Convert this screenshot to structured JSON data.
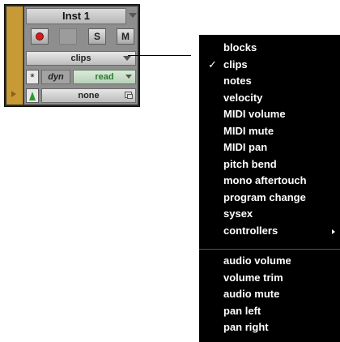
{
  "track": {
    "name": "Inst 1",
    "solo_label": "S",
    "mute_label": "M",
    "view_selector": "clips",
    "dyn_label": "dyn",
    "automation_mode": "read",
    "group": "none",
    "star_symbol": "*"
  },
  "menu": {
    "group1": [
      {
        "label": "blocks",
        "checked": false
      },
      {
        "label": "clips",
        "checked": true
      },
      {
        "label": "notes",
        "checked": false
      },
      {
        "label": "velocity",
        "checked": false
      },
      {
        "label": "MIDI volume",
        "checked": false
      },
      {
        "label": "MIDI mute",
        "checked": false
      },
      {
        "label": "MIDI pan",
        "checked": false
      },
      {
        "label": "pitch bend",
        "checked": false
      },
      {
        "label": "mono aftertouch",
        "checked": false
      },
      {
        "label": "program change",
        "checked": false
      },
      {
        "label": "sysex",
        "checked": false
      },
      {
        "label": "controllers",
        "checked": false,
        "submenu": true
      }
    ],
    "group2": [
      {
        "label": "audio volume"
      },
      {
        "label": "volume trim"
      },
      {
        "label": "audio mute"
      },
      {
        "label": "pan left"
      },
      {
        "label": "pan right"
      }
    ],
    "check_mark": "✓"
  },
  "colors": {
    "track_color": "#c79a35",
    "record_red": "#d11d1d",
    "automation_green": "#2c7a2c",
    "menu_bg": "#000000"
  }
}
